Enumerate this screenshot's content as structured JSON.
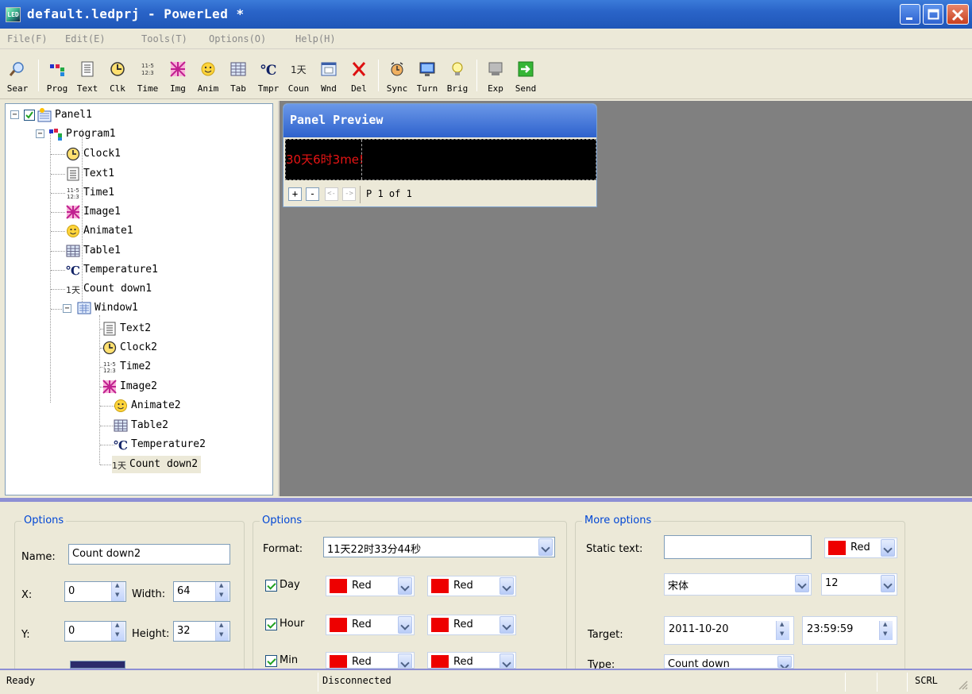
{
  "window": {
    "title": "default.ledprj - PowerLed *"
  },
  "menu": [
    "File(F)",
    "Edit(E)",
    "Tools(T)",
    "Options(O)",
    "Help(H)"
  ],
  "toolbar": [
    {
      "label": "Sear",
      "icon": "search-icon"
    },
    {
      "label": "Prog",
      "icon": "program-icon"
    },
    {
      "label": "Text",
      "icon": "text-icon"
    },
    {
      "label": "Clk",
      "icon": "clock-icon"
    },
    {
      "label": "Time",
      "icon": "time-icon"
    },
    {
      "label": "Img",
      "icon": "image-icon"
    },
    {
      "label": "Anim",
      "icon": "animation-icon"
    },
    {
      "label": "Tab",
      "icon": "table-icon"
    },
    {
      "label": "Tmpr",
      "icon": "temperature-icon"
    },
    {
      "label": "Coun",
      "icon": "countdown-icon"
    },
    {
      "label": "Wnd",
      "icon": "window-icon"
    },
    {
      "label": "Del",
      "icon": "delete-icon"
    },
    {
      "label": "Sync",
      "icon": "sync-icon"
    },
    {
      "label": "Turn",
      "icon": "turn-icon"
    },
    {
      "label": "Brig",
      "icon": "brightness-icon"
    },
    {
      "label": "Exp",
      "icon": "export-icon"
    },
    {
      "label": "Send",
      "icon": "send-icon"
    }
  ],
  "tree": {
    "panel": "Panel1",
    "program": "Program1",
    "items": [
      "Clock1",
      "Text1",
      "Time1",
      "Image1",
      "Animate1",
      "Table1",
      "Temperature1",
      "Count down1"
    ],
    "window": "Window1",
    "window_items": [
      "Text2",
      "Clock2",
      "Time2",
      "Image2",
      "Animate2",
      "Table2",
      "Temperature2",
      "Count down2"
    ]
  },
  "preview": {
    "title": "Panel Preview",
    "led_text": "30天6时3",
    "led_text2": "me!",
    "zoom_in": "+",
    "zoom_out": "-",
    "prev": "<-",
    "next": "->",
    "page": "P 1 of 1"
  },
  "options1": {
    "title": "Options",
    "name_label": "Name:",
    "name_value": "Count down2",
    "x_label": "X:",
    "x_value": "0",
    "y_label": "Y:",
    "y_value": "0",
    "width_label": "Width:",
    "width_value": "64",
    "height_label": "Height:",
    "height_value": "32"
  },
  "options2": {
    "title": "Options",
    "format_label": "Format:",
    "format_value": "11天22时33分44秒",
    "day_label": "Day",
    "hour_label": "Hour",
    "min_label": "Min",
    "color1": "Red",
    "color2": "Red"
  },
  "more": {
    "title": "More options",
    "static_label": "Static text:",
    "static_value": "",
    "static_color": "Red",
    "font_value": "宋体",
    "size_value": "12",
    "target_label": "Target:",
    "date_value": "2011-10-20",
    "time_value": "23:59:59",
    "type_label": "Type:",
    "type_value": "Count down"
  },
  "status": {
    "ready": "Ready",
    "connection": "Disconnected",
    "scrl": "SCRL"
  },
  "colors": {
    "red": "#ee0000",
    "title_blue": "#2a64c8",
    "workspace": "#808080"
  }
}
